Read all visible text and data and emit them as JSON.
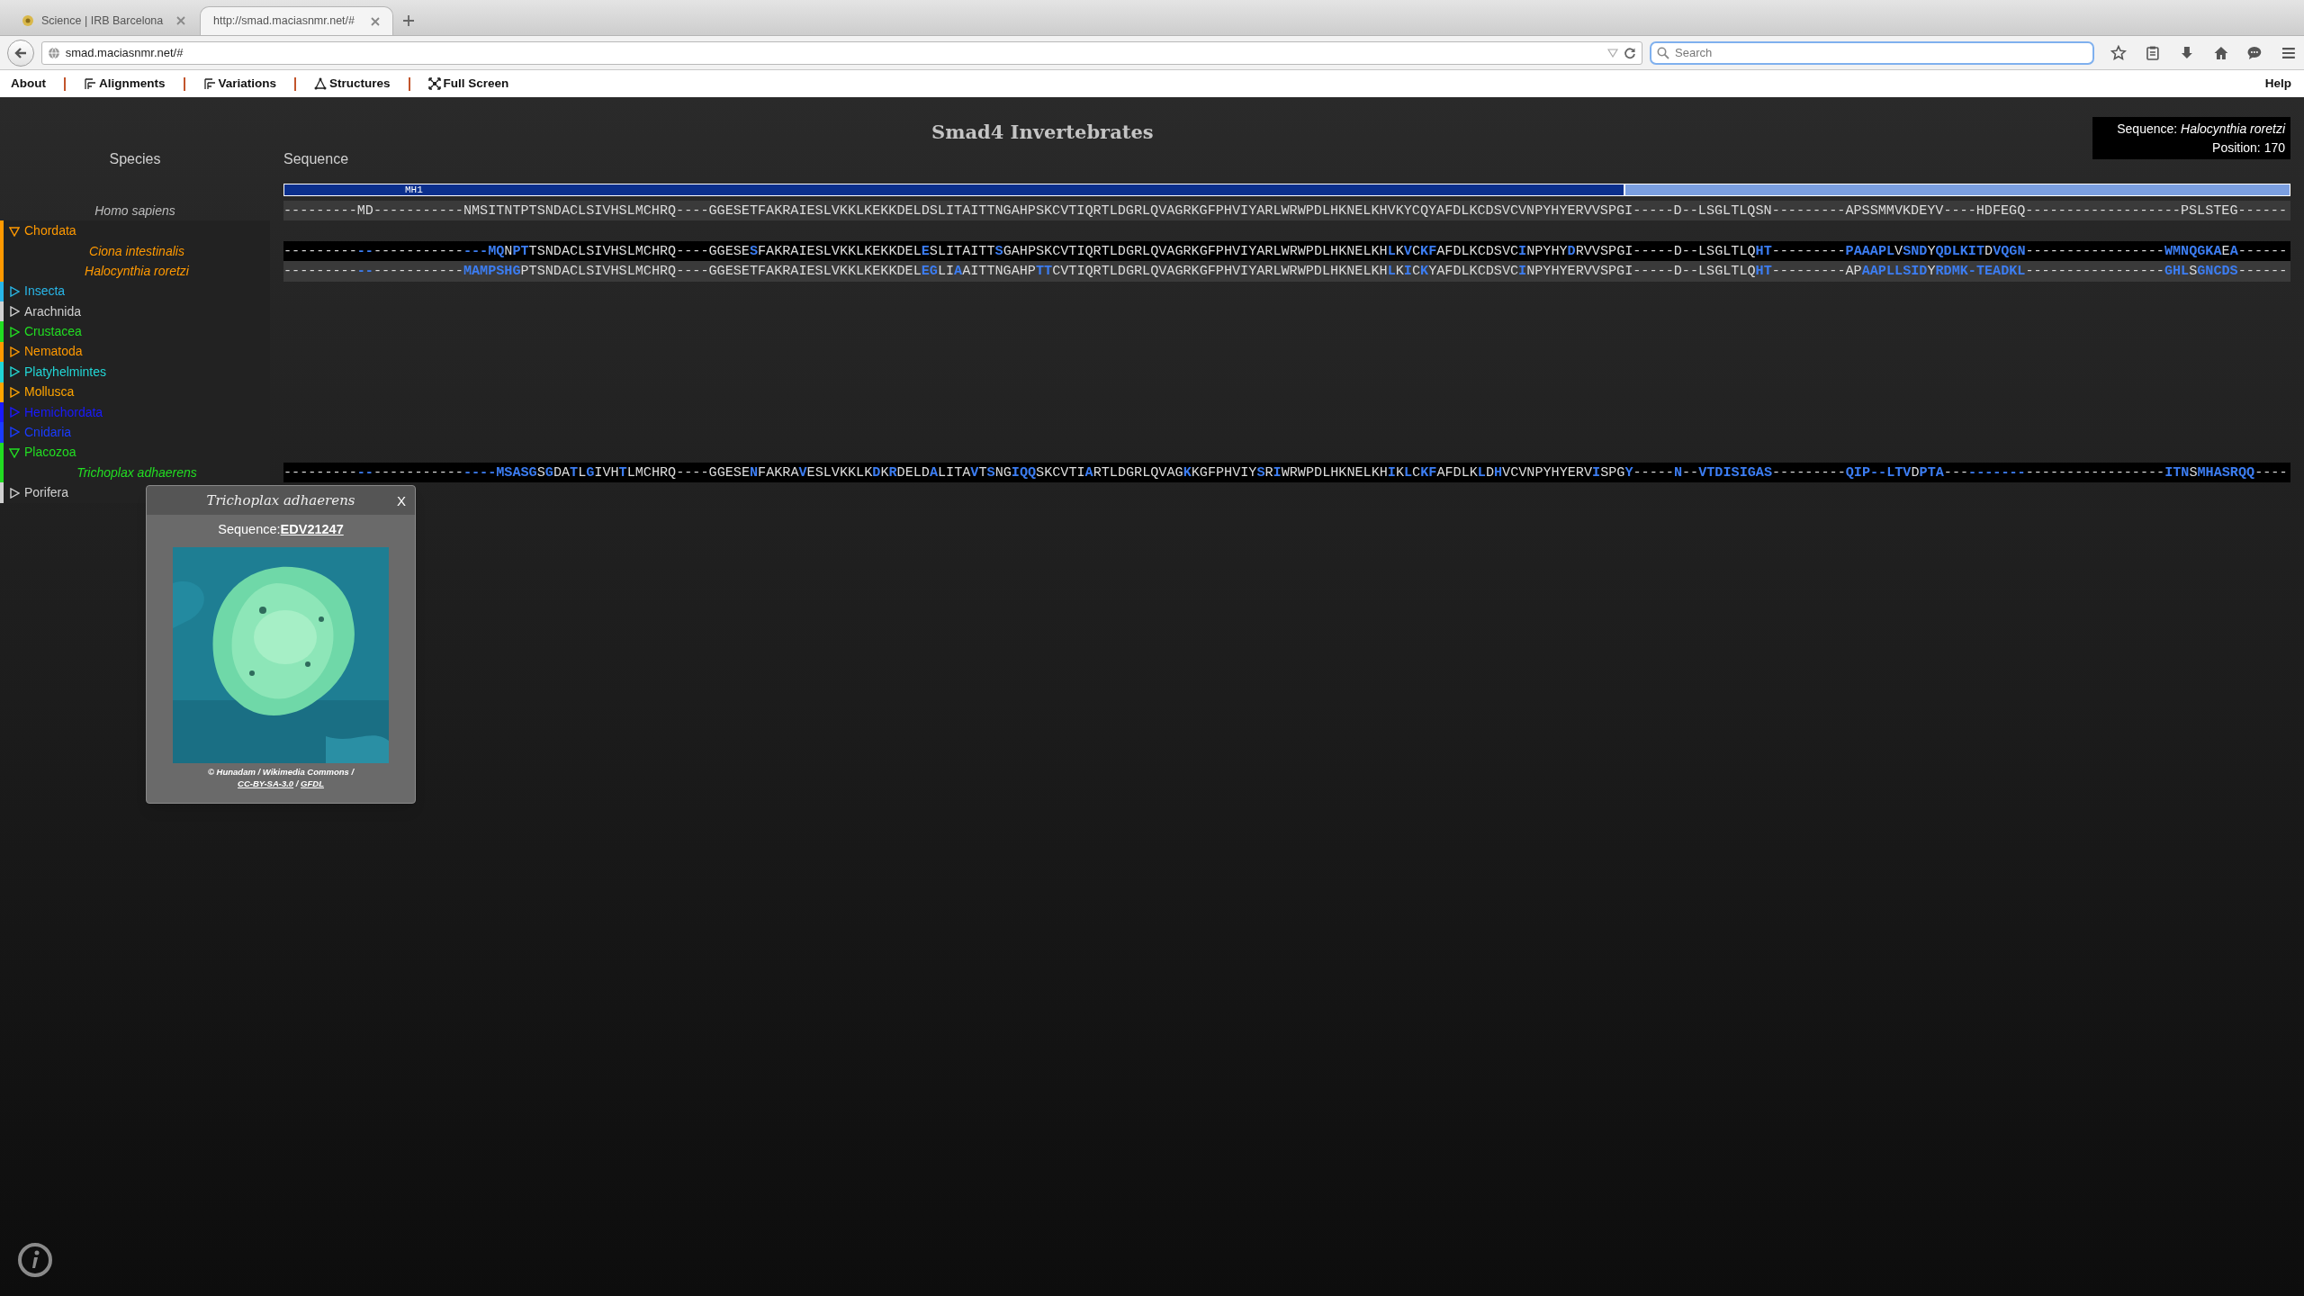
{
  "browser": {
    "tabs": [
      {
        "title": "Science | IRB Barcelona",
        "selected": false
      },
      {
        "title": "http://smad.maciasnmr.net/#",
        "selected": true
      }
    ],
    "url": "smad.maciasnmr.net/#",
    "search": {
      "placeholder": "Search"
    }
  },
  "menu": {
    "items": [
      {
        "label": "About",
        "kind": "plain"
      },
      {
        "label": "Alignments",
        "kind": "alignment"
      },
      {
        "label": "Variations",
        "kind": "alignment"
      },
      {
        "label": "Structures",
        "kind": "structure"
      },
      {
        "label": "Full Screen",
        "kind": "fullscreen"
      }
    ],
    "help": "Help"
  },
  "page": {
    "title": "Smad4 Invertebrates",
    "info": {
      "sequence": "Sequence: *Halocynthia roretzi*",
      "position": "Position: 170"
    },
    "species_header": "Species",
    "sequence_header": "Sequence",
    "domains": [
      {
        "label": "MH1",
        "selected": false
      },
      {
        "selected": true
      }
    ],
    "reference": {
      "name": "Homo sapiens",
      "sequence": [
        {
          "text": "---------MD-----------NMSITNTPTSNDACLSIVHSLMCHRQ----GGESETFAKRAIESLVKKLKEKKDELDSLITAITTNGAHPSKCVTIQRTLDGRLQVAGRKGFPHVIYARLWRWPDLHKNELKHVKYCQYAFDLKCDSVCVNPYHYERVVSPGI-----D--LSGLTLQSN---------APSSMMVKDEYV----HDFEGQ-------------------PSLSTEG------",
          "highlight": false
        }
      ]
    },
    "groups": [
      {
        "name": "Chordata",
        "color": "#ff9900",
        "expanded": true,
        "children": [
          {
            "name": "Ciona intestinalis",
            "sequence": [
              {
                "text": "---------",
                "highlight": false
              },
              {
                "text": "--",
                "highlight": true
              },
              {
                "text": "-----------",
                "highlight": false
              },
              {
                "text": "---MQ",
                "highlight": true
              },
              {
                "text": "N",
                "highlight": false
              },
              {
                "text": "PT",
                "highlight": true
              },
              {
                "text": "TSNDACLSIVHSLMCHRQ----GGESE",
                "highlight": false
              },
              {
                "text": "S",
                "highlight": true
              },
              {
                "text": "FAKRAIESLVKKLKEKKDEL",
                "highlight": false
              },
              {
                "text": "E",
                "highlight": true
              },
              {
                "text": "SLITAITT",
                "highlight": false
              },
              {
                "text": "S",
                "highlight": true
              },
              {
                "text": "GAHPSKCVTIQRTLDGRLQVAGRKGFPHVIYARLWRWPDLHKNELKH",
                "highlight": false
              },
              {
                "text": "L",
                "highlight": true
              },
              {
                "text": "K",
                "highlight": false
              },
              {
                "text": "V",
                "highlight": true
              },
              {
                "text": "C",
                "highlight": false
              },
              {
                "text": "KF",
                "highlight": true
              },
              {
                "text": "AFDLKCDSVC",
                "highlight": false
              },
              {
                "text": "I",
                "highlight": true
              },
              {
                "text": "NPYHY",
                "highlight": false
              },
              {
                "text": "D",
                "highlight": true
              },
              {
                "text": "RVVSPGI-----D--LSGLTLQ",
                "highlight": false
              },
              {
                "text": "HT",
                "highlight": true
              },
              {
                "text": "---------",
                "highlight": false
              },
              {
                "text": "PAAAPL",
                "highlight": true
              },
              {
                "text": "V",
                "highlight": false
              },
              {
                "text": "SND",
                "highlight": true
              },
              {
                "text": "Y",
                "highlight": false
              },
              {
                "text": "QDLKIT",
                "highlight": true
              },
              {
                "text": "D",
                "highlight": false
              },
              {
                "text": "VQGN",
                "highlight": true
              },
              {
                "text": "-----------------",
                "highlight": false
              },
              {
                "text": "WMNQGKA",
                "highlight": true
              },
              {
                "text": "E",
                "highlight": false
              },
              {
                "text": "A",
                "highlight": true
              },
              {
                "text": "------",
                "highlight": false
              }
            ]
          },
          {
            "name": "Halocynthia roretzi",
            "sequence": [
              {
                "text": "---------",
                "highlight": false
              },
              {
                "text": "--",
                "highlight": true
              },
              {
                "text": "-----------",
                "highlight": false
              },
              {
                "text": "MAMPSHG",
                "highlight": true
              },
              {
                "text": "PTSNDACLSIVHSLMCHRQ----GGESETFAKRAIESLVKKLKEKKDEL",
                "highlight": false
              },
              {
                "text": "EG",
                "highlight": true
              },
              {
                "text": "LI",
                "highlight": false
              },
              {
                "text": "A",
                "highlight": true
              },
              {
                "text": "AITTNGAHP",
                "highlight": false
              },
              {
                "text": "TT",
                "highlight": true
              },
              {
                "text": "CVTIQRTLDGRLQVAGRKGFPHVIYARLWRWPDLHKNELKH",
                "highlight": false
              },
              {
                "text": "L",
                "highlight": true
              },
              {
                "text": "K",
                "highlight": false
              },
              {
                "text": "I",
                "highlight": true
              },
              {
                "text": "C",
                "highlight": false
              },
              {
                "text": "K",
                "highlight": true
              },
              {
                "text": "YAFDLKCDSVC",
                "highlight": false
              },
              {
                "text": "I",
                "highlight": true
              },
              {
                "text": "NPYHYERVVSPGI-----D--LSGLTLQ",
                "highlight": false
              },
              {
                "text": "HT",
                "highlight": true
              },
              {
                "text": "---------AP",
                "highlight": false
              },
              {
                "text": "AAPLLSID",
                "highlight": true
              },
              {
                "text": "Y",
                "highlight": false
              },
              {
                "text": "RDMK-TEADKL",
                "highlight": true
              },
              {
                "text": "-----------------",
                "highlight": false
              },
              {
                "text": "GHL",
                "highlight": true
              },
              {
                "text": "S",
                "highlight": false
              },
              {
                "text": "GNCDS",
                "highlight": true
              },
              {
                "text": "------",
                "highlight": false
              }
            ]
          }
        ]
      },
      {
        "name": "Insecta",
        "color": "#29b6e8",
        "expanded": false
      },
      {
        "name": "Arachnida",
        "color": "#d0d0d0",
        "expanded": false
      },
      {
        "name": "Crustacea",
        "color": "#22dd22",
        "expanded": false
      },
      {
        "name": "Nematoda",
        "color": "#ff9900",
        "expanded": false
      },
      {
        "name": "Platyhelmintes",
        "color": "#22d6d6",
        "expanded": false
      },
      {
        "name": "Mollusca",
        "color": "#ffa500",
        "expanded": false
      },
      {
        "name": "Hemichordata",
        "color": "#1a1aff",
        "expanded": false
      },
      {
        "name": "Cnidaria",
        "color": "#1a3cff",
        "expanded": false
      },
      {
        "name": "Placozoa",
        "color": "#22dd22",
        "expanded": true,
        "children": [
          {
            "name": "Trichoplax adhaerens",
            "sequence": [
              {
                "text": "---------",
                "highlight": false
              },
              {
                "text": "--",
                "highlight": true
              },
              {
                "text": "-----------",
                "highlight": false
              },
              {
                "text": "----MSASG",
                "highlight": true
              },
              {
                "text": "S",
                "highlight": false
              },
              {
                "text": "G",
                "highlight": true
              },
              {
                "text": "DA",
                "highlight": false
              },
              {
                "text": "T",
                "highlight": true
              },
              {
                "text": "L",
                "highlight": false
              },
              {
                "text": "G",
                "highlight": true
              },
              {
                "text": "IVH",
                "highlight": false
              },
              {
                "text": "T",
                "highlight": true
              },
              {
                "text": "LMCHRQ----GGESE",
                "highlight": false
              },
              {
                "text": "N",
                "highlight": true
              },
              {
                "text": "FAKRA",
                "highlight": false
              },
              {
                "text": "V",
                "highlight": true
              },
              {
                "text": "ESLVKKLK",
                "highlight": false
              },
              {
                "text": "D",
                "highlight": true
              },
              {
                "text": "K",
                "highlight": false
              },
              {
                "text": "R",
                "highlight": true
              },
              {
                "text": "DELD",
                "highlight": false
              },
              {
                "text": "A",
                "highlight": true
              },
              {
                "text": "LITA",
                "highlight": false
              },
              {
                "text": "V",
                "highlight": true
              },
              {
                "text": "T",
                "highlight": false
              },
              {
                "text": "S",
                "highlight": true
              },
              {
                "text": "NG",
                "highlight": false
              },
              {
                "text": "IQQ",
                "highlight": true
              },
              {
                "text": "SKCVTI",
                "highlight": false
              },
              {
                "text": "A",
                "highlight": true
              },
              {
                "text": "RTLDGRLQVAG",
                "highlight": false
              },
              {
                "text": "K",
                "highlight": true
              },
              {
                "text": "KGFPHVIY",
                "highlight": false
              },
              {
                "text": "S",
                "highlight": true
              },
              {
                "text": "R",
                "highlight": false
              },
              {
                "text": "I",
                "highlight": true
              },
              {
                "text": "WRWPDLHKNELKH",
                "highlight": false
              },
              {
                "text": "I",
                "highlight": true
              },
              {
                "text": "K",
                "highlight": false
              },
              {
                "text": "L",
                "highlight": true
              },
              {
                "text": "C",
                "highlight": false
              },
              {
                "text": "KF",
                "highlight": true
              },
              {
                "text": "AFDLK",
                "highlight": false
              },
              {
                "text": "L",
                "highlight": true
              },
              {
                "text": "D",
                "highlight": false
              },
              {
                "text": "H",
                "highlight": true
              },
              {
                "text": "VCVNPYHYERV",
                "highlight": false
              },
              {
                "text": "I",
                "highlight": true
              },
              {
                "text": "SPG",
                "highlight": false
              },
              {
                "text": "Y",
                "highlight": true
              },
              {
                "text": "-----",
                "highlight": false
              },
              {
                "text": "N",
                "highlight": true
              },
              {
                "text": "--",
                "highlight": false
              },
              {
                "text": "VTDISIGAS",
                "highlight": true
              },
              {
                "text": "---------",
                "highlight": false
              },
              {
                "text": "QIP--LTV",
                "highlight": true
              },
              {
                "text": "D",
                "highlight": false
              },
              {
                "text": "PTA",
                "highlight": true
              },
              {
                "text": "---",
                "highlight": false
              },
              {
                "text": "-------",
                "highlight": true
              },
              {
                "text": "-----------------",
                "highlight": false
              },
              {
                "text": "ITN",
                "highlight": true
              },
              {
                "text": "S",
                "highlight": false
              },
              {
                "text": "MHASRQQ",
                "highlight": true
              },
              {
                "text": "----",
                "highlight": false
              }
            ]
          }
        ]
      },
      {
        "name": "Porifera",
        "color": "#d0d0d0",
        "expanded": false
      }
    ],
    "popup": {
      "title": "Trichoplax adhaerens",
      "close": "X",
      "sequence_label": "Sequence:",
      "sequence_id": "EDV21247",
      "caption": [
        {
          "text": "© Hunadam / Wikimedia Commons / ",
          "link": false
        },
        {
          "text": "CC-BY-SA-3.0",
          "link": true
        },
        {
          "text": " / ",
          "link": false
        },
        {
          "text": "GFDL",
          "link": true
        }
      ]
    }
  }
}
